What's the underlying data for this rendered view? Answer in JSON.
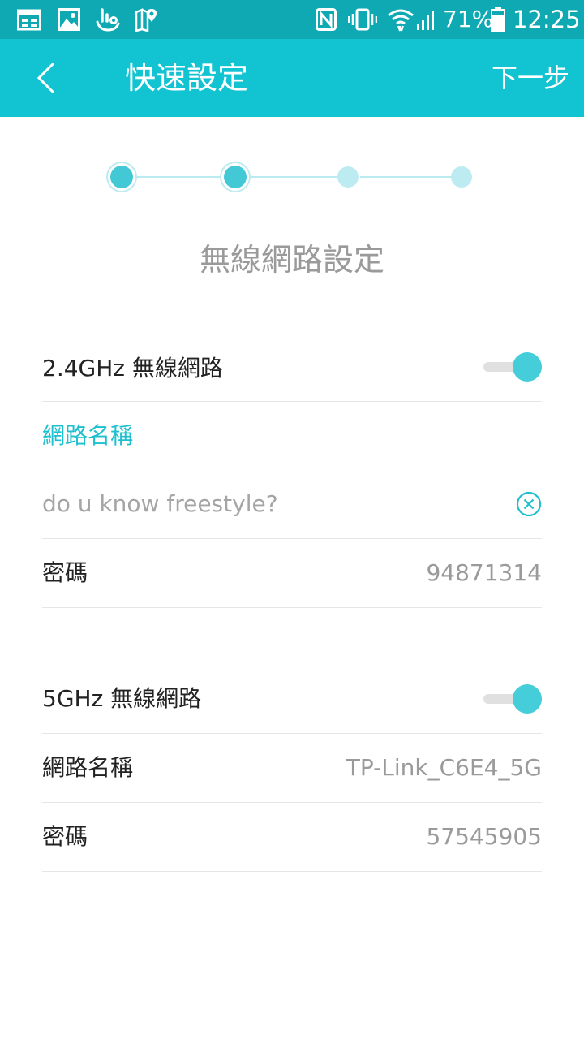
{
  "status_bar": {
    "battery_percent": "71%",
    "time": "12:25",
    "icons": [
      "calendar-icon",
      "image-icon",
      "hand-icon",
      "map-pin-icon",
      "nfc-icon",
      "vibrate-icon",
      "wifi-icon",
      "signal-icon",
      "battery-icon"
    ]
  },
  "app_bar": {
    "title": "快速設定",
    "next_label": "下一步"
  },
  "stepper": {
    "total_steps": 4,
    "current_step": 2
  },
  "heading": "無線網路設定",
  "band_24": {
    "label": "2.4GHz 無線網路",
    "enabled": true,
    "ssid_label": "網路名稱",
    "ssid_value": "do u know freestyle?",
    "password_label": "密碼",
    "password_value": "94871314"
  },
  "band_5": {
    "label": "5GHz 無線網路",
    "enabled": true,
    "ssid_label": "網路名稱",
    "ssid_value": "TP-Link_C6E4_5G",
    "password_label": "密碼",
    "password_value": "57545905"
  },
  "colors": {
    "status_bar": "#0fa9b4",
    "app_bar": "#12c3d1",
    "accent": "#43c9d6"
  }
}
